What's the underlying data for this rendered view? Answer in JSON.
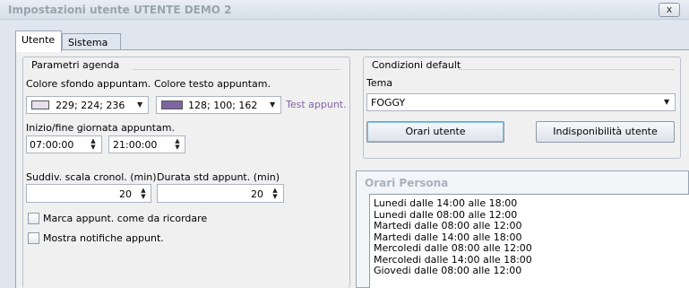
{
  "window": {
    "title": "Impostazioni utente UTENTE DEMO 2",
    "close_label": "x"
  },
  "tabs": [
    {
      "label": "Utente",
      "active": true
    },
    {
      "label": "Sistema",
      "active": false
    }
  ],
  "agenda": {
    "group_title": "Parametri agenda",
    "bg_color_label": "Colore sfondo appuntam.",
    "bg_color_value": "229; 224; 236",
    "bg_color_hex": "#e5e0ec",
    "text_color_label": "Colore testo appuntam.",
    "text_color_value": "128; 100; 162",
    "text_color_hex": "#8064a2",
    "test_label": "Test appunt.",
    "day_range_label": "Inizio/fine giornata appuntam.",
    "start_time": "07:00:00",
    "end_time": "21:00:00",
    "scale_label": "Suddiv. scala cronol. (min)",
    "scale_value": "20",
    "duration_label": "Durata std appunt. (min)",
    "duration_value": "20",
    "reminder_label": "Marca appunt. come da ricordare",
    "reminder_checked": false,
    "notify_label": "Mostra notifiche appunt.",
    "notify_checked": false
  },
  "defaults": {
    "group_title": "Condizioni default",
    "theme_label": "Tema",
    "theme_value": "FOGGY",
    "user_hours_button": "Orari utente",
    "unavailability_button": "Indisponibilità utente"
  },
  "person_hours": {
    "title": "Orari Persona",
    "items": [
      "Lunedi dalle 14:00 alle 18:00",
      "Lunedi dalle 08:00 alle 12:00",
      "Martedi dalle 08:00 alle 12:00",
      "Martedi dalle 14:00 alle 18:00",
      "Mercoledi dalle 08:00 alle 12:00",
      "Mercoledi dalle 14:00 alle 18:00",
      "Giovedi dalle 08:00 alle 12:00"
    ]
  }
}
